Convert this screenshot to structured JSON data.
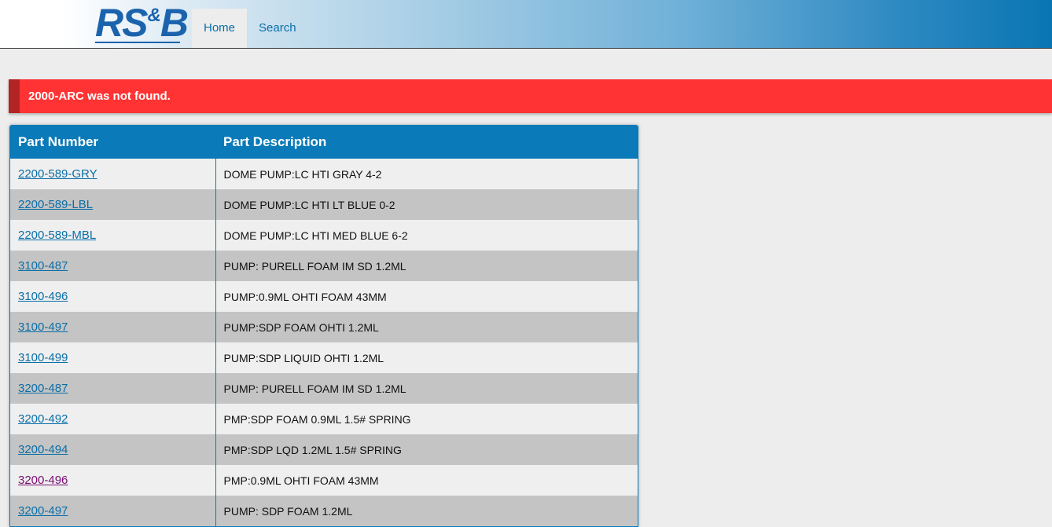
{
  "brand": {
    "logo_main": "RS",
    "logo_amp": "&",
    "logo_end": "B",
    "color": "#1b63ad"
  },
  "nav": {
    "items": [
      {
        "label": "Home",
        "active": true
      },
      {
        "label": "Search",
        "active": false
      }
    ]
  },
  "alert": {
    "message": "2000-ARC was not found.",
    "color": "#ff3333"
  },
  "table": {
    "headers": {
      "part_number": "Part Number",
      "part_description": "Part Description"
    },
    "rows": [
      {
        "part_number": "2200-589-GRY",
        "description": "DOME PUMP:LC HTI GRAY 4-2",
        "visited": false
      },
      {
        "part_number": "2200-589-LBL",
        "description": "DOME PUMP:LC HTI LT BLUE 0-2",
        "visited": false
      },
      {
        "part_number": "2200-589-MBL",
        "description": "DOME PUMP:LC HTI MED BLUE 6-2",
        "visited": false
      },
      {
        "part_number": "3100-487",
        "description": "PUMP: PURELL FOAM IM SD 1.2ML",
        "visited": false
      },
      {
        "part_number": "3100-496",
        "description": "PUMP:0.9ML OHTI FOAM 43MM",
        "visited": false
      },
      {
        "part_number": "3100-497",
        "description": "PUMP:SDP FOAM OHTI 1.2ML",
        "visited": false
      },
      {
        "part_number": "3100-499",
        "description": "PUMP:SDP LIQUID OHTI 1.2ML",
        "visited": false
      },
      {
        "part_number": "3200-487",
        "description": "PUMP: PURELL FOAM IM SD 1.2ML",
        "visited": false
      },
      {
        "part_number": "3200-492",
        "description": "PMP:SDP FOAM 0.9ML 1.5# SPRING",
        "visited": false
      },
      {
        "part_number": "3200-494",
        "description": "PMP:SDP LQD 1.2ML 1.5# SPRING",
        "visited": false
      },
      {
        "part_number": "3200-496",
        "description": "PMP:0.9ML OHTI FOAM 43MM",
        "visited": true
      },
      {
        "part_number": "3200-497",
        "description": "PUMP: SDP FOAM 1.2ML",
        "visited": false
      }
    ]
  }
}
